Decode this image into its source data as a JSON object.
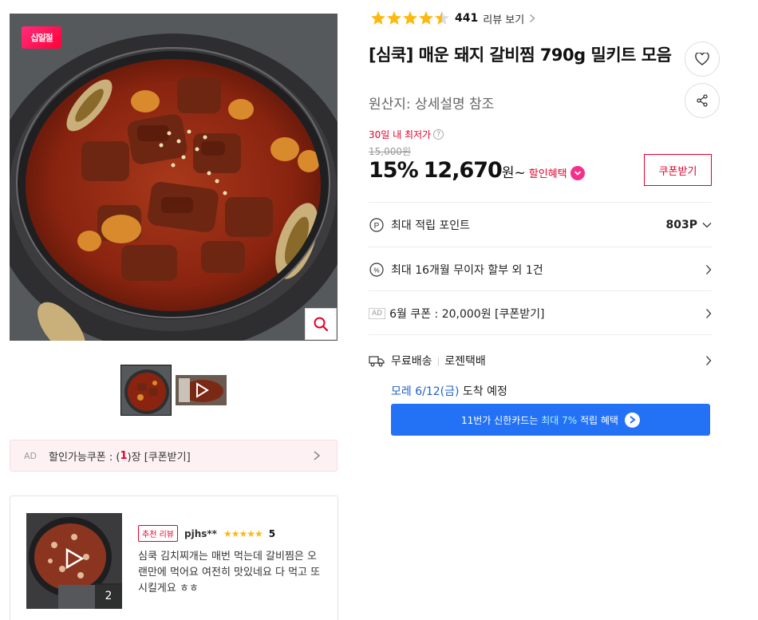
{
  "gallery": {
    "event_badge": "십일절",
    "zoom_icon": "search-icon",
    "thumbnail_video_icon": "play-icon"
  },
  "ad_coupon": {
    "ad_label": "AD",
    "text_before": "할인가능쿠폰 : (",
    "quantity": "1",
    "text_after": ")장 [쿠폰받기]"
  },
  "review": {
    "badge": "추천 리뷰",
    "reviewer": "pjhs**",
    "stars": "★★★★★",
    "score": "5",
    "text": "심쿡 김치찌개는 매번 먹는데 갈비찜은 오랜만에 먹어요 여전히 맛있네요 다 먹고 또 시킬게요 ㅎㅎ",
    "media_count": "2"
  },
  "rating": {
    "value": 4.5,
    "review_count": "441",
    "review_link": "리뷰 보기"
  },
  "product": {
    "title": "[심쿡] 매운 돼지 갈비찜 790g 밀키트 모음",
    "origin": "원산지:  상세설명 참조"
  },
  "price": {
    "lowest_label": "30일 내 최저가",
    "original": "15,000원",
    "discount": "15%",
    "value": "12,670",
    "unit": "원~",
    "benefit_link": "할인혜택",
    "coupon_button": "쿠폰받기"
  },
  "info_rows": {
    "points_label": "최대 적립 포인트",
    "points_value": "803P",
    "installment": "최대 16개월 무이자 할부 외 1건",
    "ad_label": "AD",
    "coupon": "6월 쿠폰 : 20,000원 [쿠폰받기]",
    "shipping_free": "무료배송",
    "shipping_carrier": "로젠택배",
    "arrival_date": "모레 6/12(금)",
    "arrival_suffix": "도착 예정"
  },
  "card_banner": {
    "before": "11번가 신한카드는",
    "highlight": "최대 7%",
    "after": "적립 혜택"
  },
  "colors": {
    "accent_red": "#e4002b",
    "star": "#fdb913",
    "banner_blue": "#2372f5",
    "date_blue": "#2060c9"
  }
}
